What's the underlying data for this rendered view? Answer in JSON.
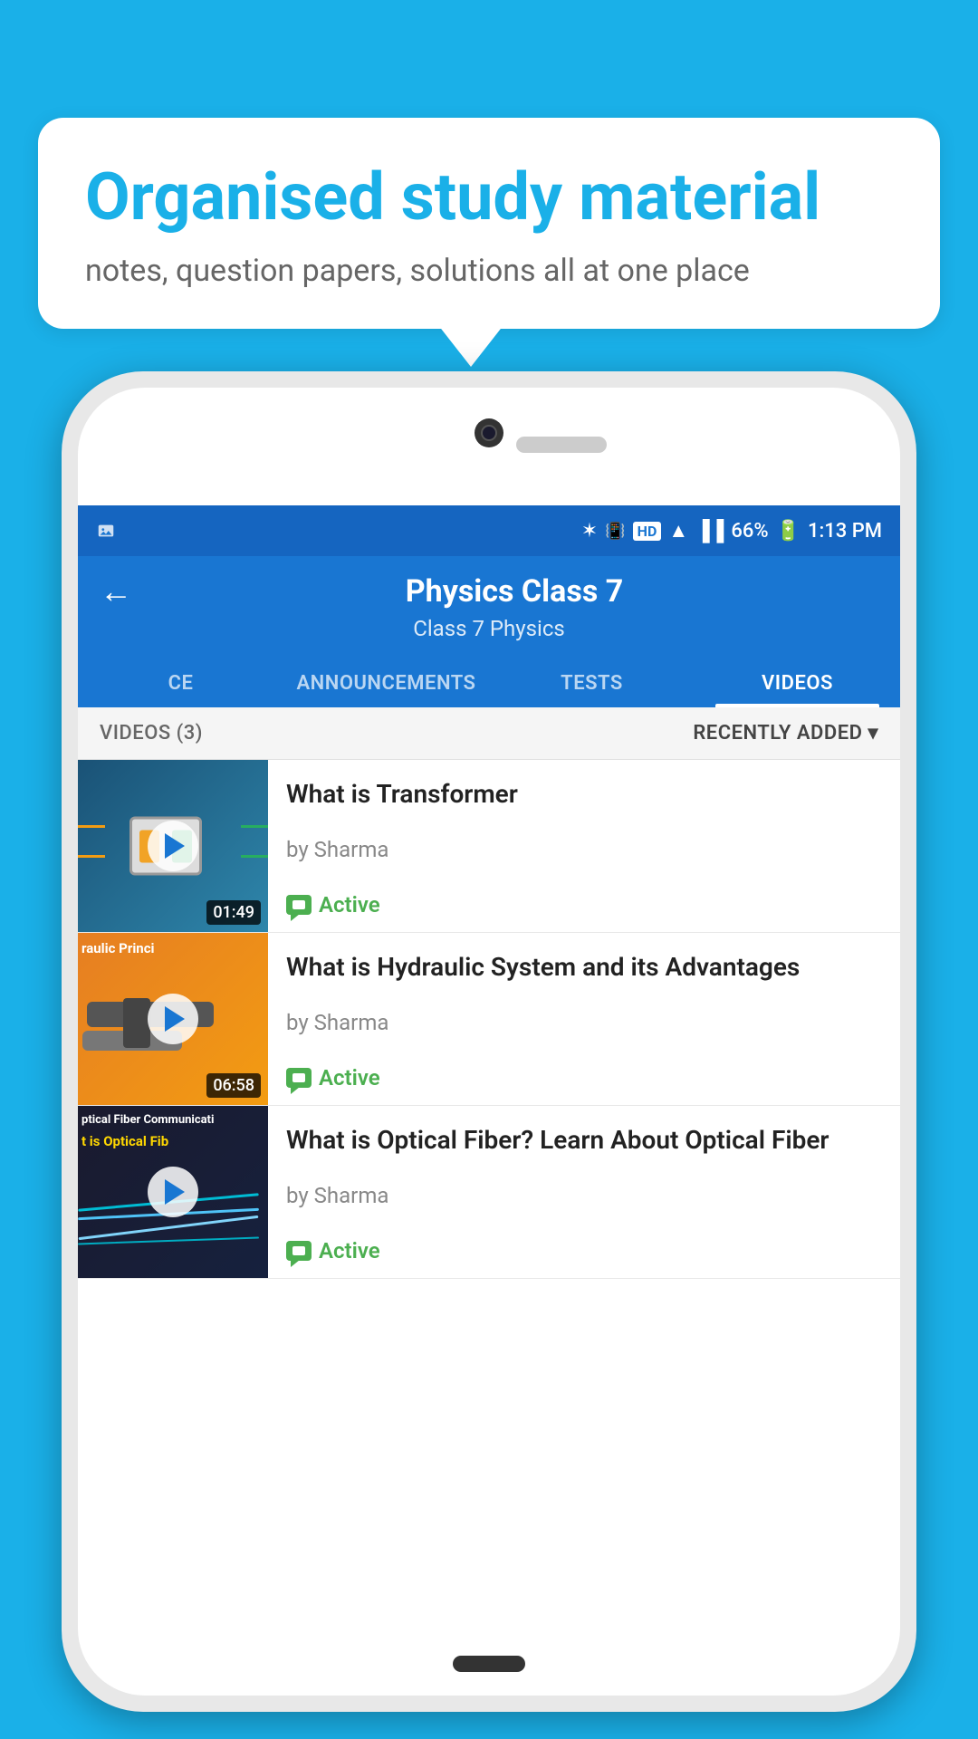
{
  "background_color": "#1ab0e8",
  "speech_bubble": {
    "title": "Organised study material",
    "subtitle": "notes, question papers, solutions all at one place"
  },
  "status_bar": {
    "battery": "66%",
    "time": "1:13 PM",
    "signal": "HD"
  },
  "app_bar": {
    "title": "Physics Class 7",
    "subtitle": "Class 7    Physics",
    "back_label": "←"
  },
  "tabs": [
    {
      "id": "ce",
      "label": "CE",
      "active": false
    },
    {
      "id": "announcements",
      "label": "ANNOUNCEMENTS",
      "active": false
    },
    {
      "id": "tests",
      "label": "TESTS",
      "active": false
    },
    {
      "id": "videos",
      "label": "VIDEOS",
      "active": true
    }
  ],
  "filter_bar": {
    "count_label": "VIDEOS (3)",
    "sort_label": "RECENTLY ADDED",
    "sort_icon": "▾"
  },
  "videos": [
    {
      "id": "v1",
      "title": "What is  Transformer",
      "author": "by Sharma",
      "duration": "01:49",
      "status": "Active",
      "thumb_type": "transformer"
    },
    {
      "id": "v2",
      "title": "What is Hydraulic System and its Advantages",
      "author": "by Sharma",
      "duration": "06:58",
      "status": "Active",
      "thumb_type": "hydraulic",
      "thumb_text": "raulic Princi"
    },
    {
      "id": "v3",
      "title": "What is Optical Fiber? Learn About Optical Fiber",
      "author": "by Sharma",
      "duration": "",
      "status": "Active",
      "thumb_type": "optical",
      "thumb_text1": "ptical Fiber Communicati",
      "thumb_text2": "t is Optical Fib"
    }
  ]
}
